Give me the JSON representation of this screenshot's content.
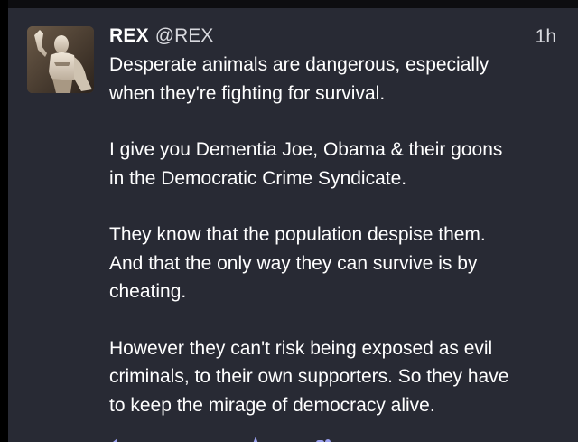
{
  "post": {
    "display_name": "REX",
    "handle": "@REX",
    "timestamp": "1h",
    "paragraphs": [
      [
        "Desperate animals are dangerous, especially",
        "when they're fighting for survival."
      ],
      [
        "I give you Dementia Joe, Obama & their goons",
        "in the Democratic Crime Syndicate."
      ],
      [
        "They know that the population despise them.",
        "And that the only way they can survive is by",
        "cheating."
      ],
      [
        "However they can't risk being exposed as evil",
        "criminals, to their own supporters. So they have",
        "to keep the mirage of democracy alive."
      ]
    ]
  },
  "actions": [
    {
      "icon": "reply-icon"
    },
    {
      "icon": "boost-icon"
    },
    {
      "icon": "favourite-icon"
    },
    {
      "icon": "bookmark-icon"
    },
    {
      "icon": "more-icon"
    }
  ],
  "colors": {
    "background": "#282a34",
    "text": "#ffffff",
    "muted": "#d8d9de",
    "icon": "#9aa0ee"
  }
}
